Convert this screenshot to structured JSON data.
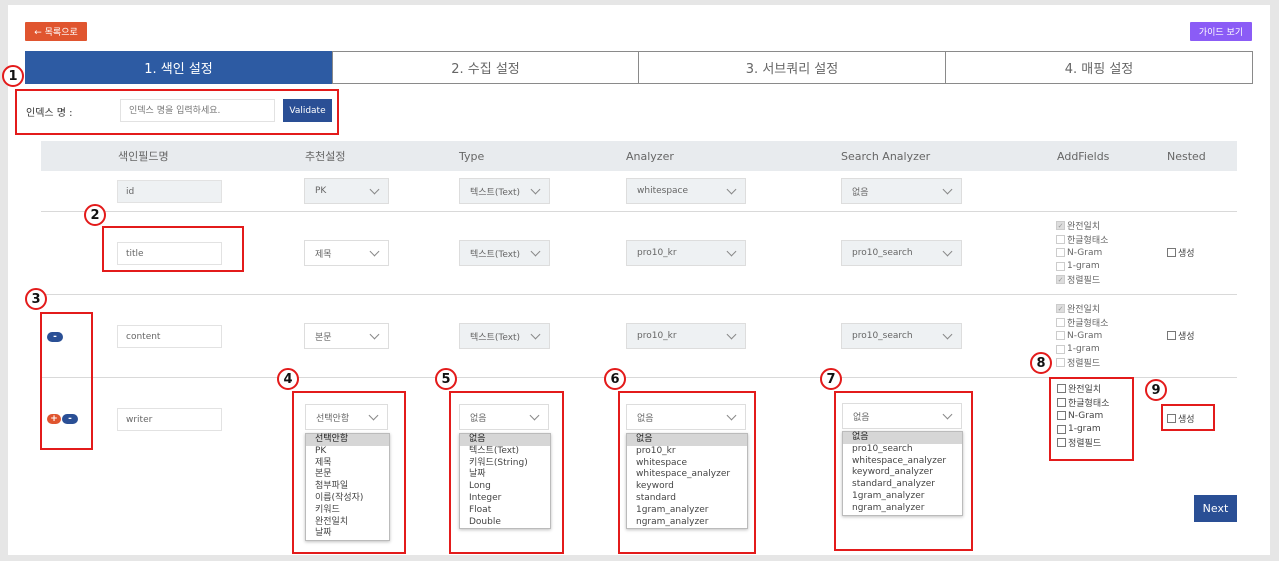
{
  "header": {
    "back_label": "← 목록으로",
    "guide_label": "가이드 보기"
  },
  "tabs": [
    {
      "label": "1. 색인 설정"
    },
    {
      "label": "2. 수집 설정"
    },
    {
      "label": "3. 서브쿼리 설정"
    },
    {
      "label": "4. 매핑 설정"
    }
  ],
  "index_name": {
    "label": "인덱스 명 :",
    "placeholder": "인덱스 명을 입력하세요.",
    "validate_label": "Validate"
  },
  "columns": [
    "색인필드명",
    "추천설정",
    "Type",
    "Analyzer",
    "Search Analyzer",
    "AddFields",
    "Nested"
  ],
  "rows": [
    {
      "field": "id",
      "recommend": "PK",
      "type": "텍스트(Text)",
      "analyzer": "whitespace",
      "search_analyzer": "없음"
    },
    {
      "field": "title",
      "recommend": "제목",
      "type": "텍스트(Text)",
      "analyzer": "pro10_kr",
      "search_analyzer": "pro10_search"
    },
    {
      "field": "content",
      "recommend": "본문",
      "type": "텍스트(Text)",
      "analyzer": "pro10_kr",
      "search_analyzer": "pro10_search"
    },
    {
      "field": "writer",
      "recommend": "선택안함",
      "type": "없음",
      "analyzer": "없음",
      "search_analyzer": "없음"
    }
  ],
  "addfields": [
    "완전일치",
    "한글형태소",
    "N-Gram",
    "1-gram",
    "정렬필드"
  ],
  "nested_label": "생성",
  "row_buttons": {
    "add": "+",
    "remove": "-"
  },
  "dropdowns": {
    "recommend": [
      "선택안함",
      "PK",
      "제목",
      "본문",
      "첨부파일",
      "이름(작성자)",
      "키워드",
      "완전일치",
      "날짜"
    ],
    "type": [
      "없음",
      "텍스트(Text)",
      "키워드(String)",
      "날짜",
      "Long",
      "Integer",
      "Float",
      "Double"
    ],
    "analyzer": [
      "없음",
      "pro10_kr",
      "whitespace",
      "whitespace_analyzer",
      "keyword",
      "standard",
      "1gram_analyzer",
      "ngram_analyzer"
    ],
    "search_analyzer": [
      "없음",
      "pro10_search",
      "whitespace_analyzer",
      "keyword_analyzer",
      "standard_analyzer",
      "1gram_analyzer",
      "ngram_analyzer"
    ]
  },
  "annotations": [
    "1",
    "2",
    "3",
    "4",
    "5",
    "6",
    "7",
    "8",
    "9"
  ],
  "next_label": "Next",
  "colors": {
    "primary": "#2d5ba3",
    "back": "#e0552f",
    "guide": "#8b5cf6",
    "annotation": "#e31b1b"
  }
}
